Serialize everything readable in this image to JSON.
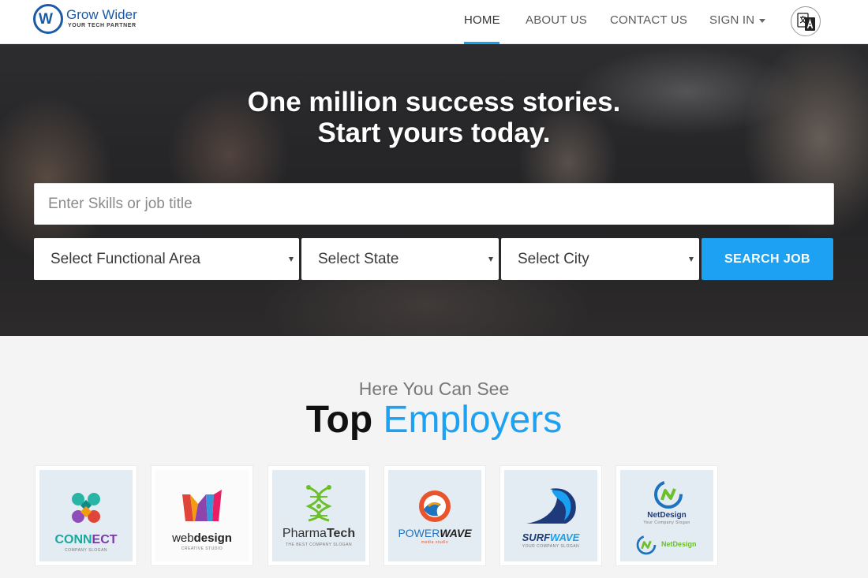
{
  "brand": {
    "name": "Grow Wider",
    "tagline": "YOUR TECH PARTNER"
  },
  "nav": {
    "home": "HOME",
    "about": "ABOUT US",
    "contact": "CONTACT US",
    "signin": "SIGN IN",
    "active": "HOME"
  },
  "hero": {
    "title_line1": "One million success stories.",
    "title_line2": "Start yours today."
  },
  "search": {
    "keyword_placeholder": "Enter Skills or job title",
    "functional_area": "Select Functional Area",
    "state": "Select State",
    "city": "Select City",
    "button": "SEARCH JOB"
  },
  "employers": {
    "subtitle": "Here You Can See",
    "title_part1": "Top",
    "title_part2": "Employers",
    "logos": [
      {
        "name_a": "CONN",
        "name_b": "ECT",
        "slogan": "COMPANY SLOGAN"
      },
      {
        "name_a": "web",
        "name_b": "design",
        "slogan": "CREATIVE STUDIO"
      },
      {
        "name_a": "Pharma",
        "name_b": "Tech",
        "slogan": "THE BEST COMPANY SLOGAN"
      },
      {
        "name_a": "POWER",
        "name_b": "WAVE",
        "slogan": "media studio"
      },
      {
        "name_a": "SURF",
        "name_b": "WAVE",
        "slogan": "YOUR COMPANY SLOGAN"
      },
      {
        "name_a": "NetDesign",
        "name_b": "NetDesign",
        "slogan": "Your Company Slogan"
      }
    ]
  },
  "colors": {
    "accent": "#1da1f2",
    "brand": "#1a5aa6",
    "page_bg": "#f4f4f4"
  }
}
